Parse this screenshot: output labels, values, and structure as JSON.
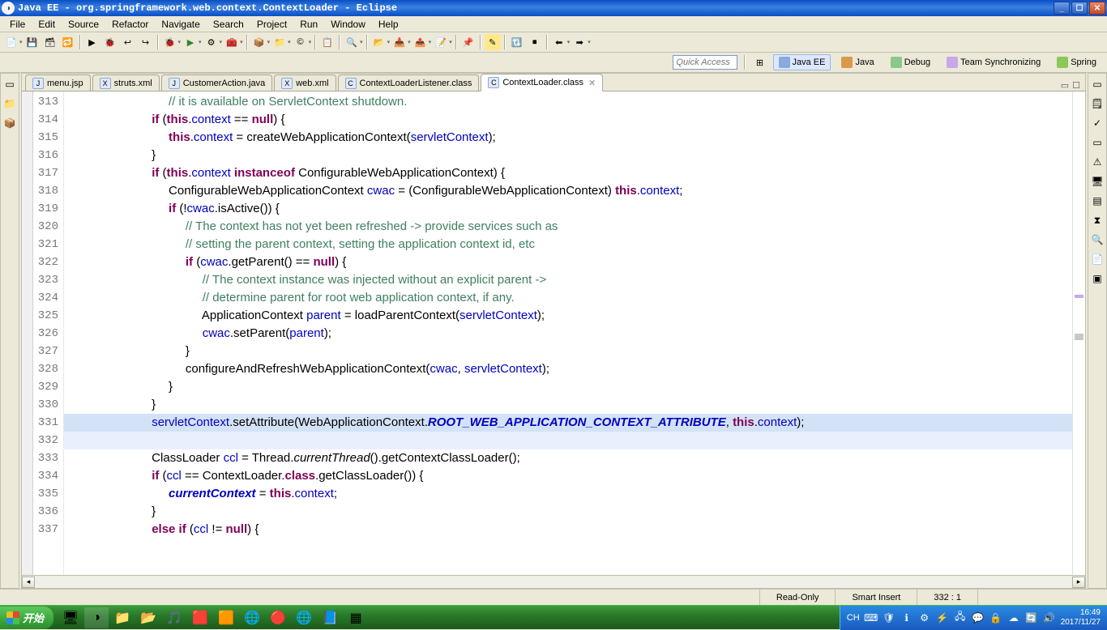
{
  "window": {
    "title": "Java EE - org.springframework.web.context.ContextLoader - Eclipse"
  },
  "menu": [
    "File",
    "Edit",
    "Source",
    "Refactor",
    "Navigate",
    "Search",
    "Project",
    "Run",
    "Window",
    "Help"
  ],
  "quick_access": {
    "placeholder": "Quick Access"
  },
  "perspectives": [
    {
      "label": "Java EE",
      "active": true
    },
    {
      "label": "Java",
      "active": false
    },
    {
      "label": "Debug",
      "active": false
    },
    {
      "label": "Team Synchronizing",
      "active": false
    },
    {
      "label": "Spring",
      "active": false
    }
  ],
  "tabs": [
    {
      "label": "menu.jsp",
      "active": false
    },
    {
      "label": "struts.xml",
      "active": false
    },
    {
      "label": "CustomerAction.java",
      "active": false
    },
    {
      "label": "web.xml",
      "active": false
    },
    {
      "label": "ContextLoaderListener.class",
      "active": false
    },
    {
      "label": "ContextLoader.class",
      "active": true
    }
  ],
  "gutter_start": 313,
  "gutter_end": 337,
  "code_lines": [
    {
      "n": 313,
      "indent": 6,
      "tokens": [
        {
          "t": "// it is available on ServletContext shutdown.",
          "c": "cm"
        }
      ]
    },
    {
      "n": 314,
      "indent": 5,
      "tokens": [
        {
          "t": "if",
          "c": "kw"
        },
        {
          "t": " ("
        },
        {
          "t": "this",
          "c": "kw"
        },
        {
          "t": "."
        },
        {
          "t": "context",
          "c": "fld"
        },
        {
          "t": " == "
        },
        {
          "t": "null",
          "c": "kw"
        },
        {
          "t": ") {"
        }
      ]
    },
    {
      "n": 315,
      "indent": 6,
      "tokens": [
        {
          "t": "this",
          "c": "kw"
        },
        {
          "t": "."
        },
        {
          "t": "context",
          "c": "fld"
        },
        {
          "t": " = createWebApplicationContext("
        },
        {
          "t": "servletContext",
          "c": "fld"
        },
        {
          "t": ");"
        }
      ]
    },
    {
      "n": 316,
      "indent": 5,
      "tokens": [
        {
          "t": "}"
        }
      ]
    },
    {
      "n": 317,
      "indent": 5,
      "tokens": [
        {
          "t": "if",
          "c": "kw"
        },
        {
          "t": " ("
        },
        {
          "t": "this",
          "c": "kw"
        },
        {
          "t": "."
        },
        {
          "t": "context",
          "c": "fld"
        },
        {
          "t": " "
        },
        {
          "t": "instanceof",
          "c": "kw"
        },
        {
          "t": " ConfigurableWebApplicationContext) {"
        }
      ]
    },
    {
      "n": 318,
      "indent": 6,
      "tokens": [
        {
          "t": "ConfigurableWebApplicationContext "
        },
        {
          "t": "cwac",
          "c": "fld"
        },
        {
          "t": " = (ConfigurableWebApplicationContext) "
        },
        {
          "t": "this",
          "c": "kw"
        },
        {
          "t": "."
        },
        {
          "t": "context",
          "c": "fld"
        },
        {
          "t": ";"
        }
      ]
    },
    {
      "n": 319,
      "indent": 6,
      "tokens": [
        {
          "t": "if",
          "c": "kw"
        },
        {
          "t": " (!"
        },
        {
          "t": "cwac",
          "c": "fld"
        },
        {
          "t": ".isActive()) {"
        }
      ]
    },
    {
      "n": 320,
      "indent": 7,
      "tokens": [
        {
          "t": "// The context has not yet been refreshed -> provide services such as",
          "c": "cm"
        }
      ]
    },
    {
      "n": 321,
      "indent": 7,
      "tokens": [
        {
          "t": "// setting the parent context, setting the application context id, etc",
          "c": "cm"
        }
      ]
    },
    {
      "n": 322,
      "indent": 7,
      "tokens": [
        {
          "t": "if",
          "c": "kw"
        },
        {
          "t": " ("
        },
        {
          "t": "cwac",
          "c": "fld"
        },
        {
          "t": ".getParent() == "
        },
        {
          "t": "null",
          "c": "kw"
        },
        {
          "t": ") {"
        }
      ]
    },
    {
      "n": 323,
      "indent": 8,
      "tokens": [
        {
          "t": "// The context instance was injected without an explicit parent ->",
          "c": "cm"
        }
      ]
    },
    {
      "n": 324,
      "indent": 8,
      "tokens": [
        {
          "t": "// determine parent for root web application context, if any.",
          "c": "cm"
        }
      ]
    },
    {
      "n": 325,
      "indent": 8,
      "tokens": [
        {
          "t": "ApplicationContext "
        },
        {
          "t": "parent",
          "c": "fld"
        },
        {
          "t": " = loadParentContext("
        },
        {
          "t": "servletContext",
          "c": "fld"
        },
        {
          "t": ");"
        }
      ]
    },
    {
      "n": 326,
      "indent": 8,
      "tokens": [
        {
          "t": "cwac",
          "c": "fld"
        },
        {
          "t": ".setParent("
        },
        {
          "t": "parent",
          "c": "fld"
        },
        {
          "t": ");"
        }
      ]
    },
    {
      "n": 327,
      "indent": 7,
      "tokens": [
        {
          "t": "}"
        }
      ]
    },
    {
      "n": 328,
      "indent": 7,
      "tokens": [
        {
          "t": "configureAndRefreshWebApplicationContext("
        },
        {
          "t": "cwac",
          "c": "fld"
        },
        {
          "t": ", "
        },
        {
          "t": "servletContext",
          "c": "fld"
        },
        {
          "t": ");"
        }
      ]
    },
    {
      "n": 329,
      "indent": 6,
      "tokens": [
        {
          "t": "}"
        }
      ]
    },
    {
      "n": 330,
      "indent": 5,
      "tokens": [
        {
          "t": "}"
        }
      ]
    },
    {
      "n": 331,
      "indent": 5,
      "hl": "hl2",
      "tokens": [
        {
          "t": "servletContext",
          "c": "fld"
        },
        {
          "t": ".setAttribute(WebApplicationContext."
        },
        {
          "t": "ROOT_WEB_APPLICATION_CONTEXT_ATTRIBUTE",
          "c": "str-it"
        },
        {
          "t": ", "
        },
        {
          "t": "this",
          "c": "kw"
        },
        {
          "t": "."
        },
        {
          "t": "context",
          "c": "fld"
        },
        {
          "t": ");"
        }
      ]
    },
    {
      "n": 332,
      "indent": 0,
      "hl": "hl",
      "tokens": []
    },
    {
      "n": 333,
      "indent": 5,
      "tokens": [
        {
          "t": "ClassLoader "
        },
        {
          "t": "ccl",
          "c": "fld"
        },
        {
          "t": " = Thread."
        },
        {
          "t": "currentThread",
          "c": "st-it"
        },
        {
          "t": "().getContextClassLoader();"
        }
      ]
    },
    {
      "n": 334,
      "indent": 5,
      "tokens": [
        {
          "t": "if",
          "c": "kw"
        },
        {
          "t": " ("
        },
        {
          "t": "ccl",
          "c": "fld"
        },
        {
          "t": " == ContextLoader."
        },
        {
          "t": "class",
          "c": "kw"
        },
        {
          "t": ".getClassLoader()) {"
        }
      ]
    },
    {
      "n": 335,
      "indent": 6,
      "tokens": [
        {
          "t": "currentContext",
          "c": "str-it"
        },
        {
          "t": " = "
        },
        {
          "t": "this",
          "c": "kw"
        },
        {
          "t": "."
        },
        {
          "t": "context",
          "c": "fld"
        },
        {
          "t": ";"
        }
      ]
    },
    {
      "n": 336,
      "indent": 5,
      "tokens": [
        {
          "t": "}"
        }
      ]
    },
    {
      "n": 337,
      "indent": 5,
      "tokens": [
        {
          "t": "else if",
          "c": "kw"
        },
        {
          "t": " ("
        },
        {
          "t": "ccl",
          "c": "fld"
        },
        {
          "t": " != "
        },
        {
          "t": "null",
          "c": "kw"
        },
        {
          "t": ") {"
        }
      ]
    }
  ],
  "status": {
    "read_only": "Read-Only",
    "insert": "Smart Insert",
    "pos": "332 : 1"
  },
  "taskbar": {
    "start": "开始",
    "ime": "CH",
    "time": "16:49",
    "date": "2017/11/27"
  }
}
